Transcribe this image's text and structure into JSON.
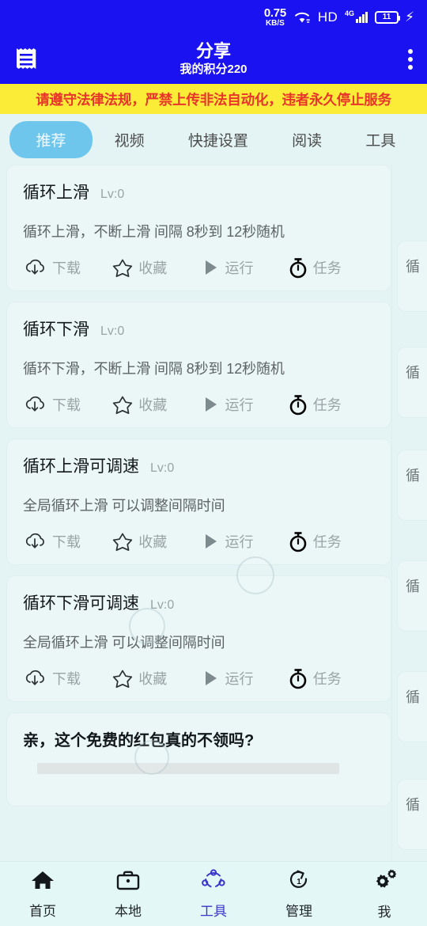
{
  "statusbar": {
    "net_speed_value": "0.75",
    "net_speed_unit": "KB/S",
    "wifi_icon": "wifi-icon",
    "hd_label": "HD",
    "network_type": "4G",
    "signal_icon": "signal-bars-icon",
    "battery_level": "11",
    "charging_icon": "lightning-bolt-icon"
  },
  "appbar": {
    "menu_icon": "receipt-list-icon",
    "title": "分享",
    "subtitle": "我的积分220",
    "more_icon": "more-vertical-icon"
  },
  "notice": {
    "text": "请遵守法律法规，严禁上传非法自动化，违者永久停止服务",
    "bg_color": "#fbec38",
    "text_color": "#e8342a"
  },
  "tabs": {
    "active_index": 0,
    "active_bg": "#6fc6ed",
    "items": [
      {
        "label": "推荐"
      },
      {
        "label": "视频"
      },
      {
        "label": "快捷设置"
      },
      {
        "label": "阅读"
      },
      {
        "label": "工具"
      }
    ]
  },
  "action_labels": {
    "download": "下载",
    "favorite": "收藏",
    "run": "运行",
    "task": "任务"
  },
  "cards": [
    {
      "title": "循环上滑",
      "level": "Lv:0",
      "description": "循环上滑，不断上滑 间隔 8秒到 12秒随机"
    },
    {
      "title": "循环下滑",
      "level": "Lv:0",
      "description": "循环下滑，不断上滑 间隔 8秒到 12秒随机"
    },
    {
      "title": "循环上滑可调速",
      "level": "Lv:0",
      "description": "全局循环上滑 可以调整间隔时间"
    },
    {
      "title": "循环下滑可调速",
      "level": "Lv:0",
      "description": "全局循环上滑 可以调整间隔时间"
    }
  ],
  "promo": {
    "title": "亲，这个免费的红包真的不领吗?"
  },
  "side_column": {
    "clipped_chars": [
      "循",
      "循",
      "循",
      "循",
      "循",
      "循"
    ]
  },
  "bottomnav": {
    "active_index": 2,
    "active_color": "#3b35c9",
    "items": [
      {
        "label": "首页",
        "icon": "home-icon"
      },
      {
        "label": "本地",
        "icon": "briefcase-icon"
      },
      {
        "label": "工具",
        "icon": "share-nodes-icon"
      },
      {
        "label": "管理",
        "icon": "refresh-one-icon"
      },
      {
        "label": "我",
        "icon": "gears-icon"
      }
    ]
  }
}
